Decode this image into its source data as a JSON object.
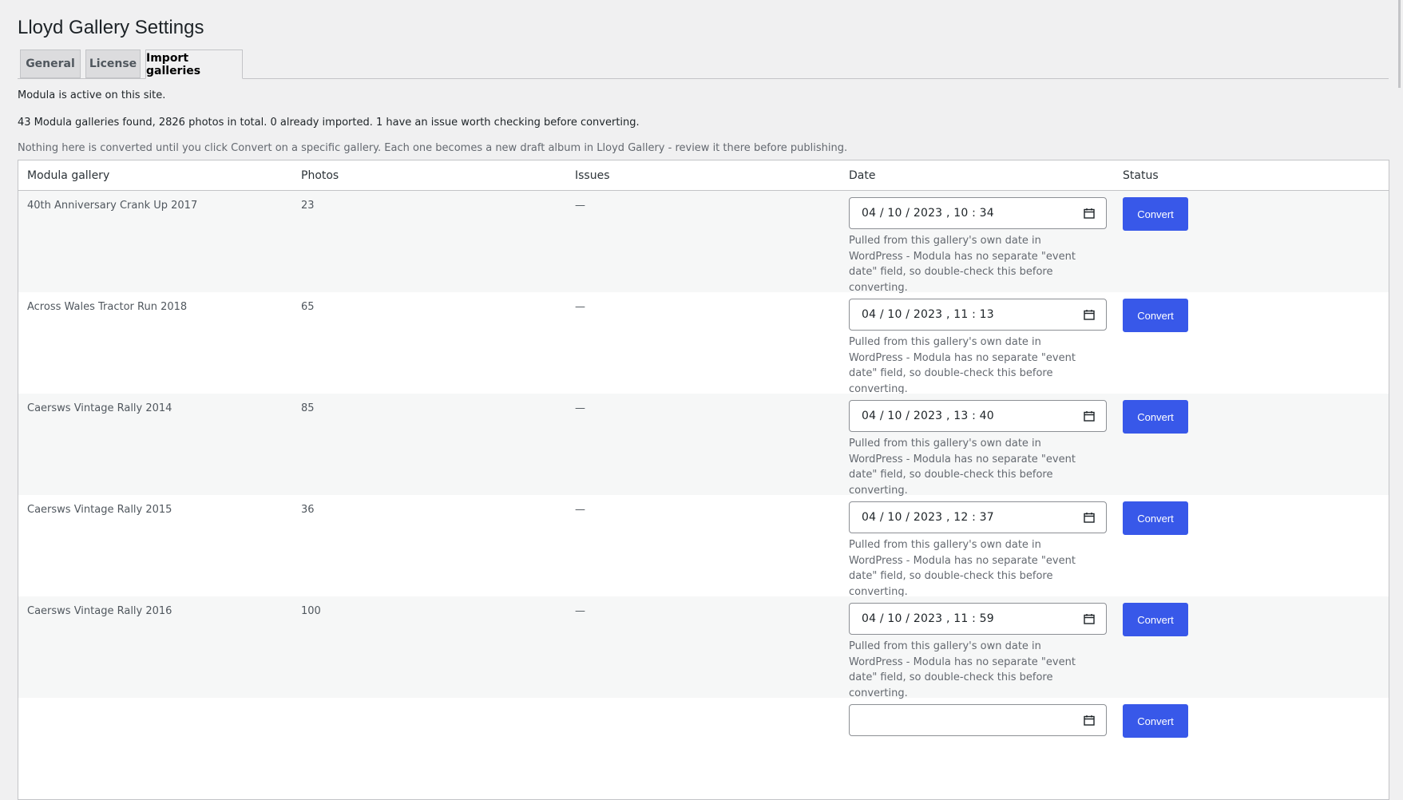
{
  "page": {
    "title": "Lloyd Gallery Settings"
  },
  "tabs": [
    {
      "label": "General"
    },
    {
      "label": "License"
    },
    {
      "label": "Import galleries"
    }
  ],
  "notices": {
    "active": "Modula is active on this site.",
    "summary": "43 Modula galleries found, 2826 photos in total. 0 already imported. 1 have an issue worth checking before converting.",
    "help": "Nothing here is converted until you click Convert on a specific gallery. Each one becomes a new draft album in Lloyd Gallery - review it there before publishing."
  },
  "table": {
    "headers": [
      "Modula gallery",
      "Photos",
      "Issues",
      "Date",
      "Status"
    ],
    "rows": [
      {
        "name": "40th Anniversary Crank Up 2017",
        "photos": "23",
        "issues": "—",
        "date": "04 / 10 / 2023 ,  10 : 34",
        "help": "Pulled from this gallery's own date in WordPress - Modula has no separate \"event date\" field, so double-check this before converting.",
        "action": "Convert"
      },
      {
        "name": "Across Wales Tractor Run 2018",
        "photos": "65",
        "issues": "—",
        "date": "04 / 10 / 2023 ,  11 : 13",
        "help": "Pulled from this gallery's own date in WordPress - Modula has no separate \"event date\" field, so double-check this before converting.",
        "action": "Convert"
      },
      {
        "name": "Caersws Vintage Rally 2014",
        "photos": "85",
        "issues": "—",
        "date": "04 / 10 / 2023 ,  13 : 40",
        "help": "Pulled from this gallery's own date in WordPress - Modula has no separate \"event date\" field, so double-check this before converting.",
        "action": "Convert"
      },
      {
        "name": "Caersws Vintage Rally 2015",
        "photos": "36",
        "issues": "—",
        "date": "04 / 10 / 2023 ,  12 : 37",
        "help": "Pulled from this gallery's own date in WordPress - Modula has no separate \"event date\" field, so double-check this before converting.",
        "action": "Convert"
      },
      {
        "name": "Caersws Vintage Rally 2016",
        "photos": "100",
        "issues": "—",
        "date": "04 / 10 / 2023 ,  11 : 59",
        "help": "Pulled from this gallery's own date in WordPress - Modula has no separate \"event date\" field, so double-check this before converting.",
        "action": "Convert"
      },
      {
        "name": "",
        "photos": "",
        "issues": "",
        "date": "",
        "help": "",
        "action": "Convert"
      }
    ]
  },
  "icons": {
    "date_picker": "calendar-icon"
  },
  "colors": {
    "primary_button": "#3858e9",
    "background": "#f0f0f1",
    "alt_row": "#f6f7f7"
  }
}
